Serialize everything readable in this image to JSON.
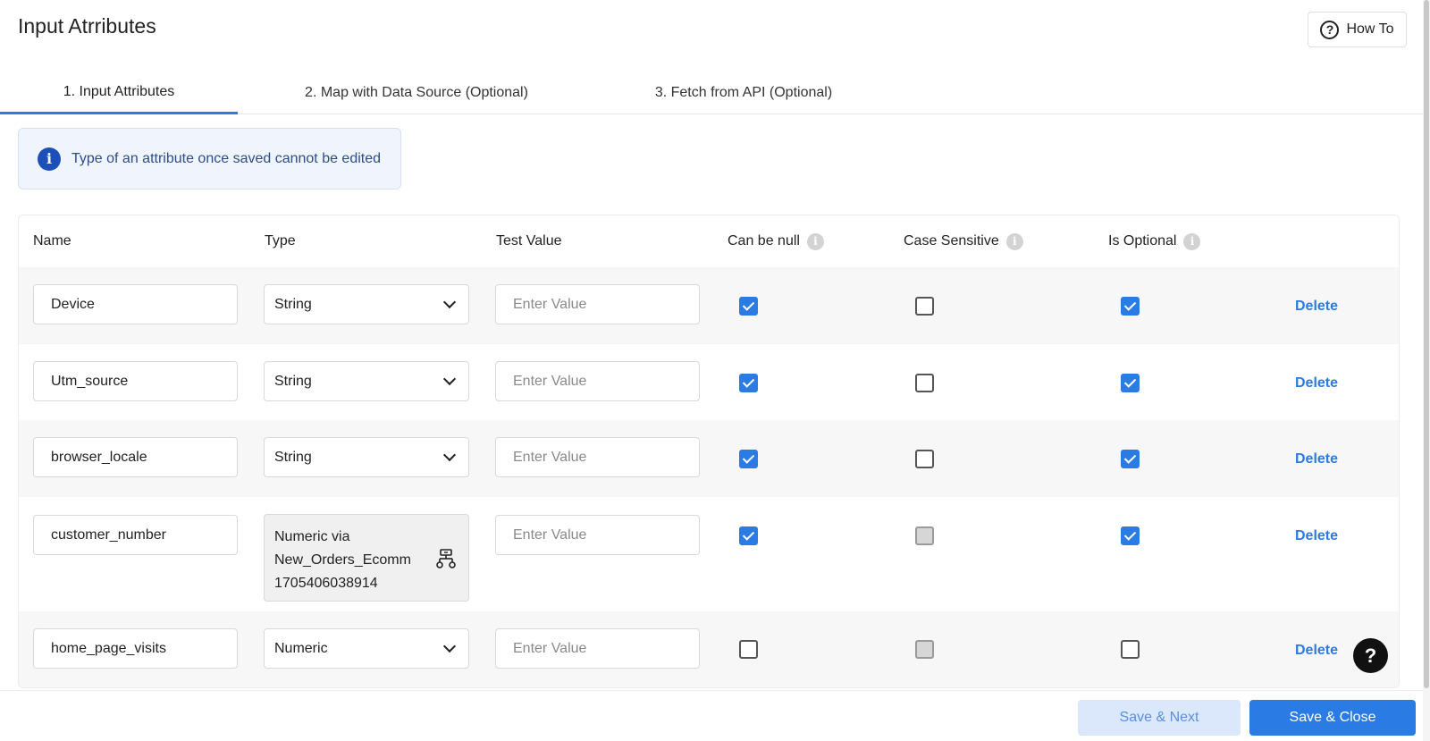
{
  "header": {
    "title": "Input Atrributes",
    "howto_label": "How To"
  },
  "tabs": [
    {
      "label": "1. Input Attributes",
      "active": true
    },
    {
      "label": "2. Map with Data Source (Optional)",
      "active": false
    },
    {
      "label": "3. Fetch from API (Optional)",
      "active": false
    }
  ],
  "info_banner": {
    "text": "Type of an attribute once saved cannot be edited"
  },
  "table": {
    "columns": {
      "name": "Name",
      "type": "Type",
      "test_value": "Test Value",
      "can_be_null": "Can be null",
      "case_sensitive": "Case Sensitive",
      "is_optional": "Is Optional"
    },
    "test_value_placeholder": "Enter Value",
    "delete_label": "Delete",
    "rows": [
      {
        "name": "Device",
        "type": "String",
        "can_be_null": true,
        "case_sensitive": false,
        "is_optional": true
      },
      {
        "name": "Utm_source",
        "type": "String",
        "can_be_null": true,
        "case_sensitive": false,
        "is_optional": true
      },
      {
        "name": "browser_locale",
        "type": "String",
        "can_be_null": true,
        "case_sensitive": false,
        "is_optional": true
      },
      {
        "name": "customer_number",
        "type_lines": [
          "Numeric via",
          "New_Orders_Ecomm",
          "1705406038914"
        ],
        "can_be_null": true,
        "case_sensitive": "disabled",
        "is_optional": true
      },
      {
        "name": "home_page_visits",
        "type": "Numeric",
        "can_be_null": false,
        "case_sensitive": "disabled",
        "is_optional": false
      }
    ]
  },
  "footer": {
    "save_next_label": "Save & Next",
    "save_close_label": "Save & Close"
  },
  "help_fab": "?",
  "colors": {
    "accent": "#2b7be4",
    "info_bg": "#f0f5fd",
    "info_icon": "#1d4fb8"
  }
}
